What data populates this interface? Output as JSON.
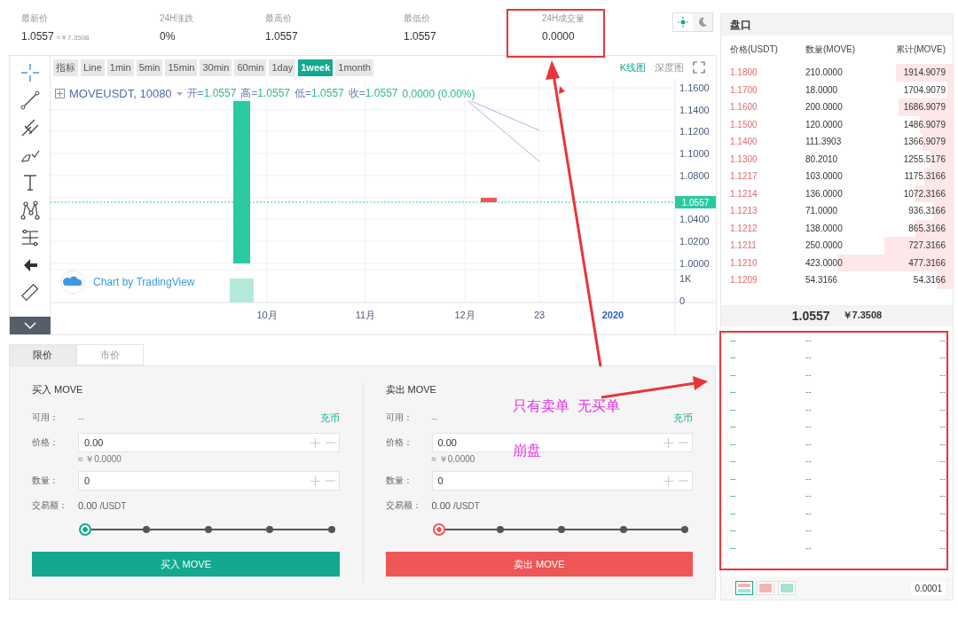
{
  "stats": [
    {
      "label": "最新价",
      "value": "1.0557",
      "sub": "≈￥7.3508"
    },
    {
      "label": "24H涨跌",
      "value": "0%"
    },
    {
      "label": "最高价",
      "value": "1.0557"
    },
    {
      "label": "最低价",
      "value": "1.0557"
    },
    {
      "label": "24H成交量",
      "value": "0.0000"
    }
  ],
  "theme": [
    {
      "kind": "light",
      "selected": true
    },
    {
      "kind": "dark",
      "selected": false
    }
  ],
  "intervals": [
    {
      "label": "指标",
      "selected": false
    },
    {
      "label": "Line",
      "selected": false
    },
    {
      "label": "1min",
      "selected": false
    },
    {
      "label": "5min",
      "selected": false
    },
    {
      "label": "15min",
      "selected": false
    },
    {
      "label": "30min",
      "selected": false
    },
    {
      "label": "60min",
      "selected": false
    },
    {
      "label": "1day",
      "selected": false
    },
    {
      "label": "1week",
      "selected": true
    },
    {
      "label": "1month",
      "selected": false
    }
  ],
  "views": [
    {
      "label": "K线图",
      "selected": true
    },
    {
      "label": "深度图",
      "selected": false
    }
  ],
  "legend": {
    "symbol": "MOVEUSDT, 10080",
    "ohlc": [
      {
        "label": "开=",
        "value": "1.0557"
      },
      {
        "label": "高=",
        "value": "1.0557"
      },
      {
        "label": "低=",
        "value": "1.0557"
      },
      {
        "label": "收=",
        "value": "1.0557"
      }
    ],
    "change": "0.0000 (0.00%)"
  },
  "price_axis": [
    "1.1600",
    "1.1400",
    "1.1200",
    "1.1000",
    "1.0800",
    "1.0400",
    "1.0200",
    "1.0000"
  ],
  "volume_axis": [
    "1K",
    "0"
  ],
  "time_axis": [
    "10月",
    "11月",
    "12月",
    "23",
    "2020"
  ],
  "last_price_tag": "1.0557",
  "attribution": "Chart by TradingView",
  "order_tabs": [
    {
      "label": "限价",
      "selected": true
    },
    {
      "label": "市价",
      "selected": false
    }
  ],
  "forms": [
    {
      "kind": "buy",
      "title": "买入 MOVE",
      "available_label": "可用：",
      "available_value": "--",
      "deposit": "充币",
      "price_label": "价格：",
      "price_value": "0.00",
      "price_cny": "≈ ￥0.0000",
      "amount_label": "数量：",
      "amount_value": "0",
      "total_label": "交易额：",
      "total_value": "0.00",
      "total_unit": "/USDT",
      "level": 0,
      "button": "买入 MOVE"
    },
    {
      "kind": "sell",
      "title": "卖出 MOVE",
      "available_label": "可用：",
      "available_value": "--",
      "deposit": "充币",
      "price_label": "价格：",
      "price_value": "0.00",
      "price_cny": "≈ ￥0.0000",
      "amount_label": "数量：",
      "amount_value": "0",
      "total_label": "交易额：",
      "total_value": "0.00",
      "total_unit": "/USDT",
      "level": 0,
      "button": "卖出 MOVE"
    }
  ],
  "order_book": {
    "title": "盘口",
    "columns": [
      "价格(USDT)",
      "数量(MOVE)",
      "累计(MOVE)"
    ],
    "asks": [
      {
        "price": "1.1800",
        "amount": "210.0000",
        "total": "1914.9079"
      },
      {
        "price": "1.1700",
        "amount": "18.0000",
        "total": "1704.9079"
      },
      {
        "price": "1.1600",
        "amount": "200.0000",
        "total": "1686.9079"
      },
      {
        "price": "1.1500",
        "amount": "120.0000",
        "total": "1486.9079"
      },
      {
        "price": "1.1400",
        "amount": "111.3903",
        "total": "1366.9079"
      },
      {
        "price": "1.1300",
        "amount": "80.2010",
        "total": "1255.5176"
      },
      {
        "price": "1.1217",
        "amount": "103.0000",
        "total": "1175.3166"
      },
      {
        "price": "1.1214",
        "amount": "136.0000",
        "total": "1072.3166"
      },
      {
        "price": "1.1213",
        "amount": "71.0000",
        "total": "936.3166"
      },
      {
        "price": "1.1212",
        "amount": "138.0000",
        "total": "865.3166"
      },
      {
        "price": "1.1211",
        "amount": "250.0000",
        "total": "727.3166"
      },
      {
        "price": "1.1210",
        "amount": "423.0000",
        "total": "477.3166"
      },
      {
        "price": "1.1209",
        "amount": "54.3166",
        "total": "54.3166"
      }
    ],
    "last_price": "1.0557",
    "last_price_cny": "￥7.3508",
    "bids": [
      {
        "price": "--",
        "amount": "--",
        "total": "--"
      },
      {
        "price": "--",
        "amount": "--",
        "total": "--"
      },
      {
        "price": "--",
        "amount": "--",
        "total": "--"
      },
      {
        "price": "--",
        "amount": "--",
        "total": "--"
      },
      {
        "price": "--",
        "amount": "--",
        "total": "--"
      },
      {
        "price": "--",
        "amount": "--",
        "total": "--"
      },
      {
        "price": "--",
        "amount": "--",
        "total": "--"
      },
      {
        "price": "--",
        "amount": "--",
        "total": "--"
      },
      {
        "price": "--",
        "amount": "--",
        "total": "--"
      },
      {
        "price": "--",
        "amount": "--",
        "total": "--"
      },
      {
        "price": "--",
        "amount": "--",
        "total": "--"
      },
      {
        "price": "--",
        "amount": "--",
        "total": "--"
      },
      {
        "price": "--",
        "amount": "--",
        "total": "--"
      }
    ],
    "layouts": [
      {
        "kind": "both",
        "selected": true
      },
      {
        "kind": "asks",
        "selected": false
      },
      {
        "kind": "bids",
        "selected": false
      }
    ],
    "depth_value": "0.0001"
  },
  "annotations": [
    "只有卖单  无买单",
    "崩盘"
  ]
}
